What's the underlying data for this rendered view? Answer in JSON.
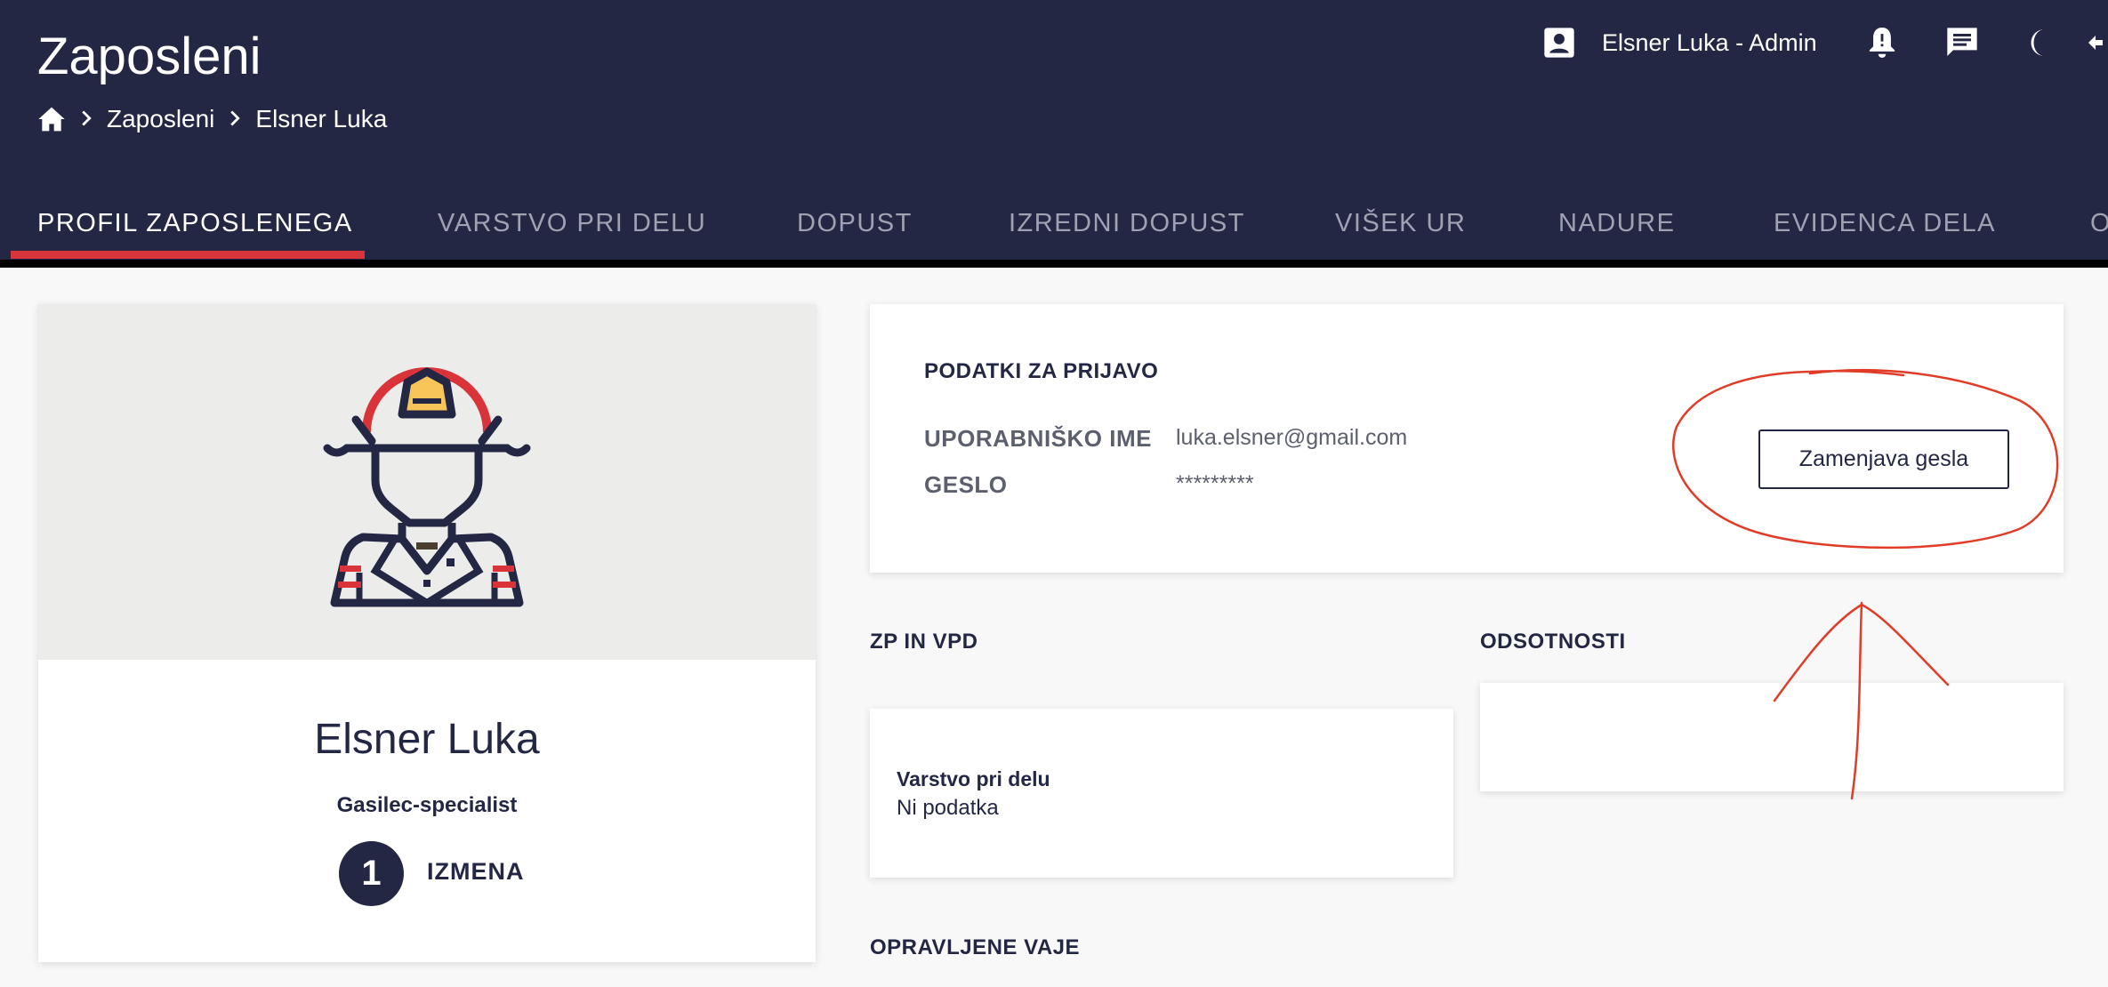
{
  "header": {
    "app_title": "Zaposleni",
    "breadcrumb": [
      "Zaposleni",
      "Elsner Luka"
    ],
    "user_label": "Elsner Luka - Admin"
  },
  "tabs": [
    {
      "label": "PROFIL ZAPOSLENEGA",
      "active": true
    },
    {
      "label": "VARSTVO PRI DELU"
    },
    {
      "label": "DOPUST"
    },
    {
      "label": "IZREDNI DOPUST"
    },
    {
      "label": "VIŠEK UR"
    },
    {
      "label": "NADURE"
    },
    {
      "label": "EVIDENCA DELA"
    },
    {
      "label": "O"
    }
  ],
  "profile": {
    "name": "Elsner Luka",
    "role": "Gasilec-specialist",
    "shift_number": "1",
    "shift_label": "IZMENA"
  },
  "login": {
    "title": "PODATKI ZA PRIJAVO",
    "username_label": "UPORABNIŠKO IME",
    "username_value": "luka.elsner@gmail.com",
    "password_label": "GESLO",
    "password_value": "*********",
    "change_password_button": "Zamenjava gesla"
  },
  "sections": {
    "zp_vpd_title": "ZP IN VPD",
    "safety_title": "Varstvo pri delu",
    "safety_value": "Ni podatka",
    "absences_title": "ODSOTNOSTI",
    "exercises_title": "OPRAVLJENE VAJE"
  },
  "colors": {
    "header_bg": "#232744",
    "accent": "#d9343a",
    "helmet_badge": "#f7c55a",
    "annotation": "#e03c28"
  },
  "icons": [
    "home-icon",
    "chevron-right-icon",
    "account-box-icon",
    "bell-icon",
    "message-icon",
    "moon-icon",
    "logout-icon"
  ]
}
